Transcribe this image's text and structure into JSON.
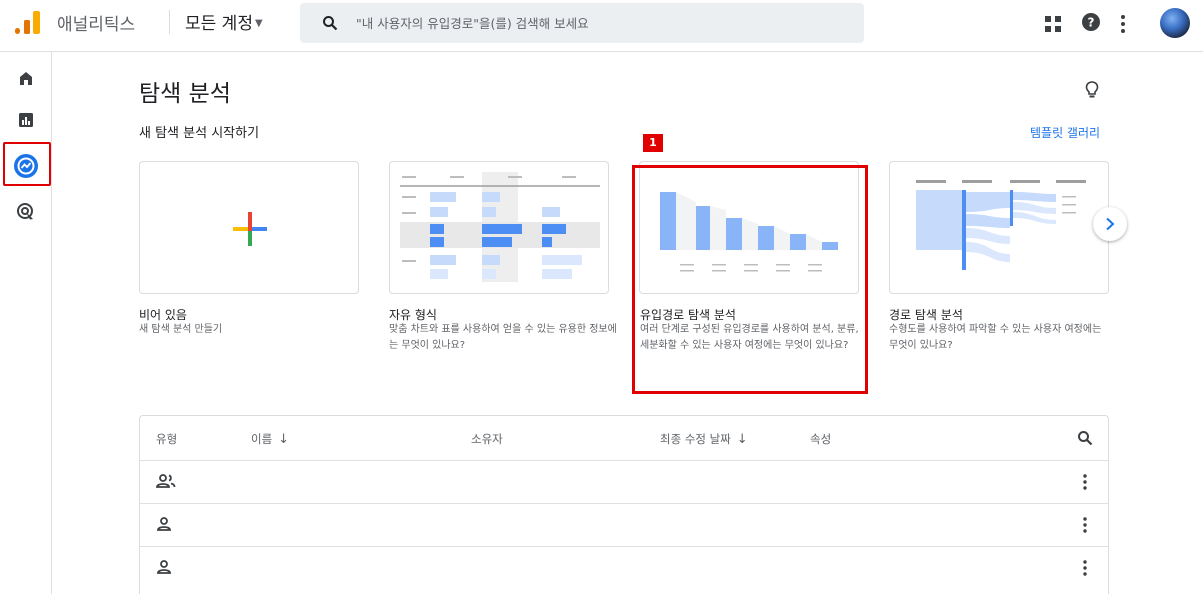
{
  "header": {
    "app_name": "애널리틱스",
    "account": "모든 계정",
    "search_placeholder": "\"내 사용자의 유입경로\"을(를) 검색해 보세요",
    "avatar": "user-avatar"
  },
  "rail": {
    "items": [
      "home-icon",
      "reports-icon",
      "explore-icon",
      "advertising-icon"
    ],
    "active": "explore-icon"
  },
  "main": {
    "title": "탐색 분석",
    "new_section": "새 탐색 분석 시작하기",
    "gallery_link": "템플릿 갤러리",
    "badge": "1",
    "cards": [
      {
        "title": "비어 있음",
        "desc": "새 탐색 분석 만들기"
      },
      {
        "title": "자유 형식",
        "desc": "맞춤 차트와 표를 사용하여 얻을 수 있는 유용한 정보에는 무엇이 있나요?"
      },
      {
        "title": "유입경로 탐색 분석",
        "desc": "여러 단계로 구성된 유입경로를 사용하여 분석, 분류, 세분화할 수 있는 사용자 여정에는 무엇이 있나요?"
      },
      {
        "title": "경로 탐색 분석",
        "desc": "수형도를 사용하여 파악할 수 있는 사용자 여정에는 무엇이 있나요?"
      }
    ]
  },
  "table": {
    "columns": {
      "type": "유형",
      "name": "이름",
      "owner": "소유자",
      "modified": "최종 수정 날짜",
      "property": "속성"
    },
    "rows": [
      {
        "type_icon": "shared-users-icon"
      },
      {
        "type_icon": "user-icon"
      },
      {
        "type_icon": "user-icon"
      }
    ]
  },
  "colors": {
    "accent": "#1a73e8",
    "highlight": "#e10000",
    "bar_blue": "#8ab4f8"
  }
}
